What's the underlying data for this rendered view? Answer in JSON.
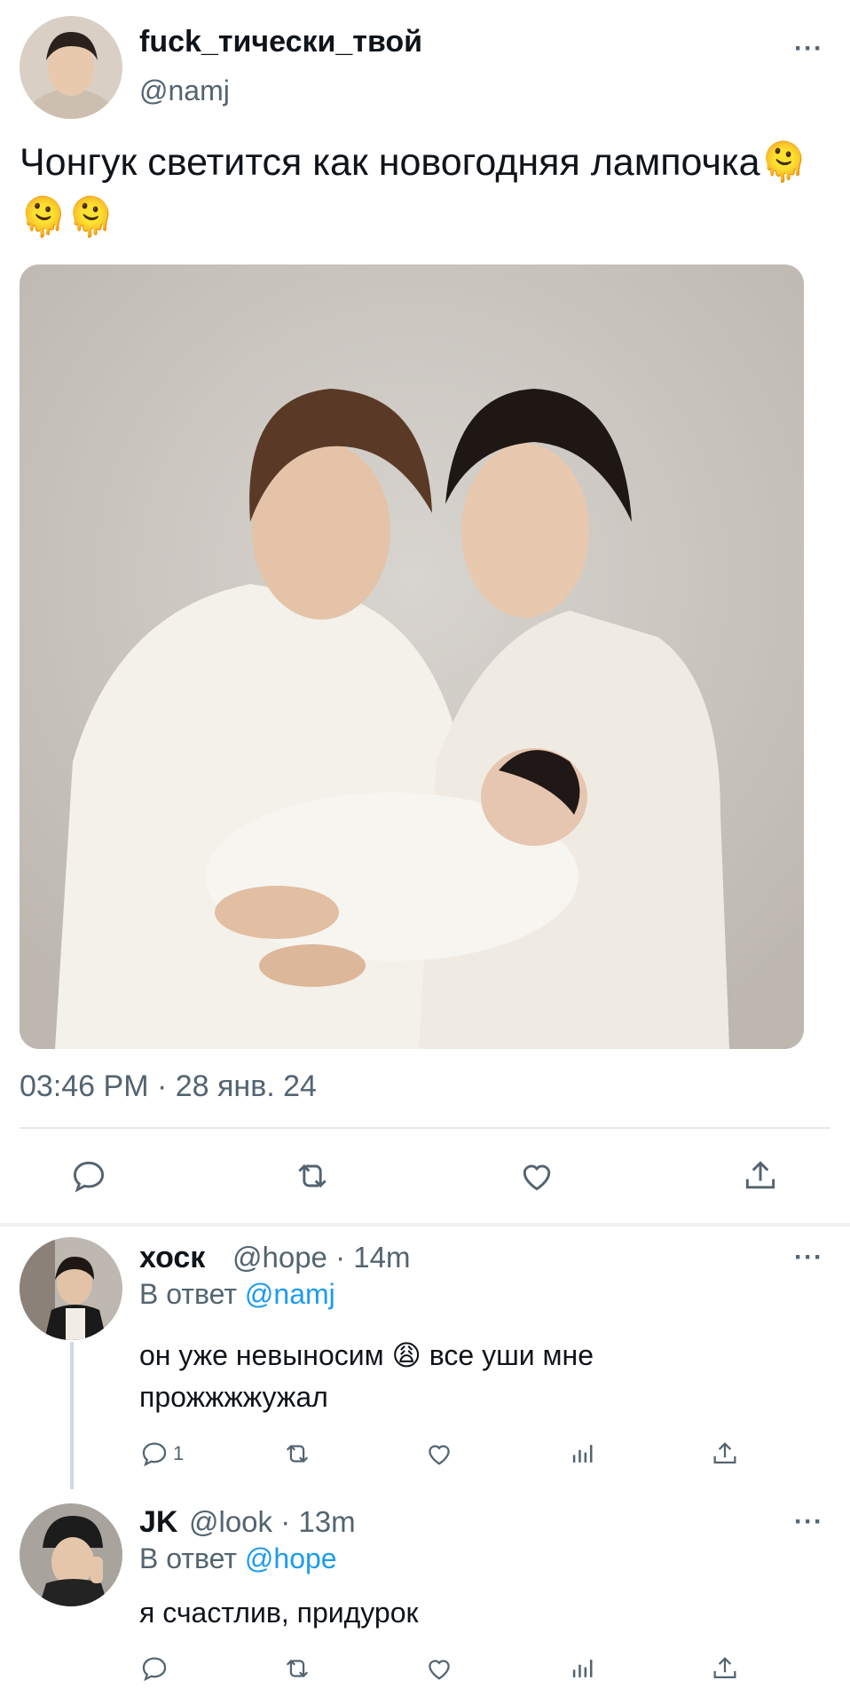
{
  "main_tweet": {
    "display_name": "fuck_тически_твой",
    "handle": "@namj",
    "text": "Чонгук светится как новогодняя лампочка🫠🫠🫠",
    "timestamp": "03:46 PM · 28 янв. 24",
    "more_icon": "···",
    "actions": [
      "reply-icon",
      "retweet-icon",
      "like-icon",
      "share-icon"
    ]
  },
  "replies": [
    {
      "display_name": "хоск",
      "meta": "@hope · 14m",
      "in_reply_prefix": "В ответ",
      "in_reply_mention": "@namj",
      "text_line1": "он уже невыносим 😩  все уши мне",
      "text_line2": "прожжжжужал",
      "reply_count": "1",
      "more_icon": "···"
    },
    {
      "display_name": "JK",
      "meta": "@look · 13m",
      "in_reply_prefix": "В ответ",
      "in_reply_mention": "@hope",
      "text_line1": "я счастлив, придурок",
      "reply_count": "",
      "more_icon": "···"
    }
  ],
  "colors": {
    "text": "#0f1419",
    "secondary": "#536471",
    "accent": "#1d9bf0",
    "separator": "#e6e9ec"
  }
}
